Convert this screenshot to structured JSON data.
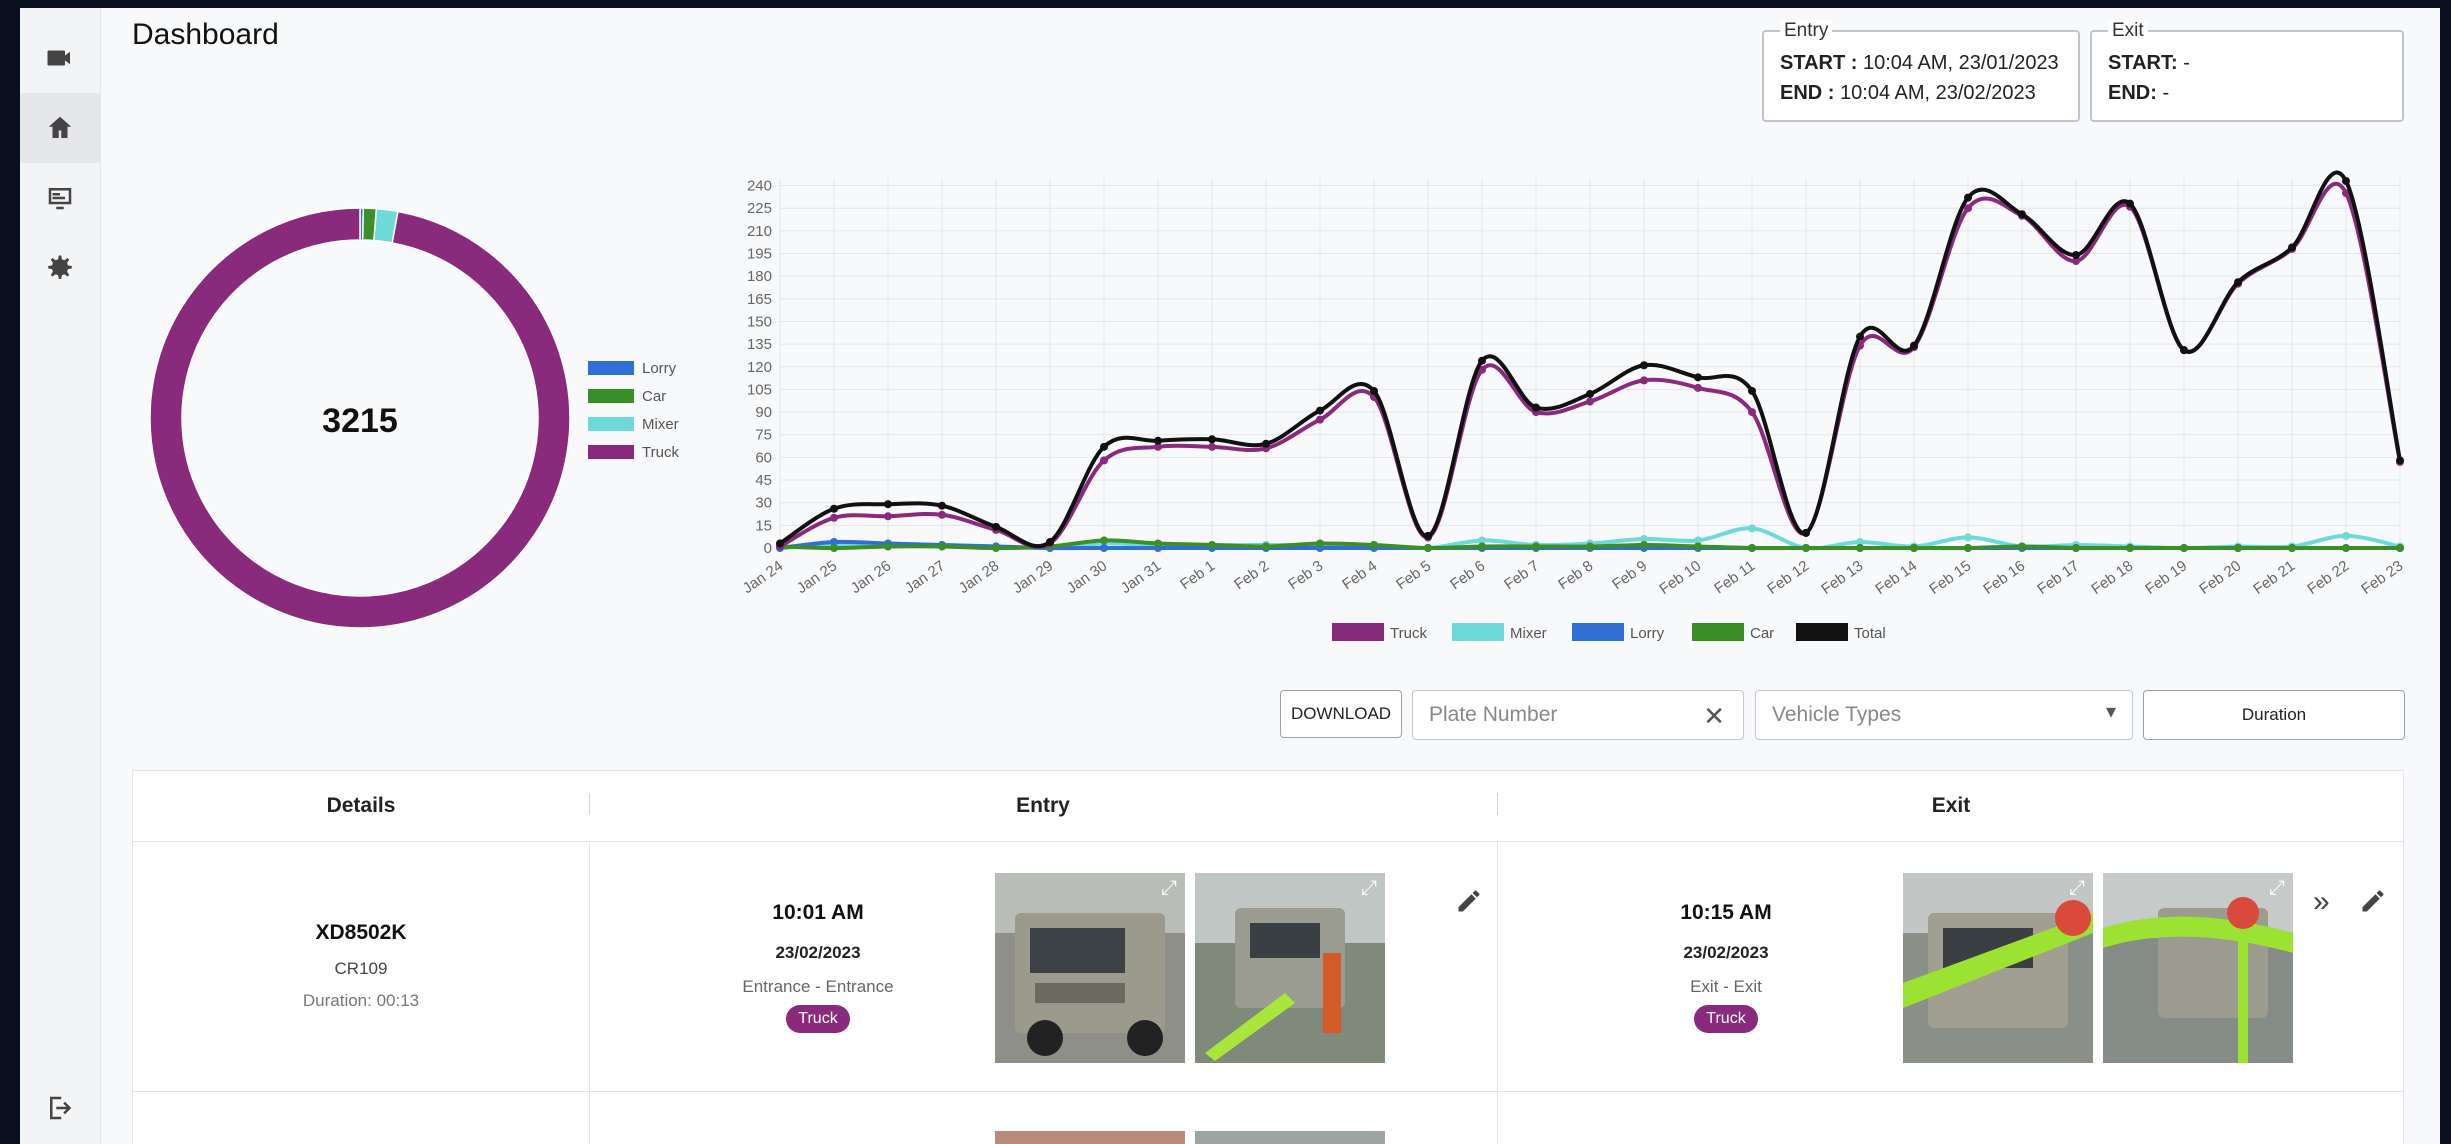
{
  "page": {
    "title": "Dashboard"
  },
  "sidebar": {
    "items": [
      {
        "name": "camera",
        "icon": "video-camera-icon"
      },
      {
        "name": "home",
        "icon": "home-icon",
        "active": true
      },
      {
        "name": "screen",
        "icon": "display-icon"
      },
      {
        "name": "settings",
        "icon": "gear-icon"
      }
    ],
    "logout_icon": "logout-icon"
  },
  "entry_range": {
    "legend": "Entry",
    "start_label": "START :",
    "start_value": "10:04 AM, 23/01/2023",
    "end_label": "END :",
    "end_value": "10:04 AM, 23/02/2023"
  },
  "exit_range": {
    "legend": "Exit",
    "start_label": "START:",
    "start_value": "-",
    "end_label": "END:",
    "end_value": "-"
  },
  "colors": {
    "truck": "#8a2a7c",
    "mixer": "#6ed9d9",
    "lorry": "#2f6fd6",
    "car": "#3a8f28",
    "total": "#111111"
  },
  "chart_data": [
    {
      "type": "pie",
      "center_label": "3215",
      "legend": [
        "Lorry",
        "Car",
        "Mixer",
        "Truck"
      ],
      "values": {
        "Lorry": 8,
        "Car": 32,
        "Mixer": 53,
        "Truck": 3122
      }
    },
    {
      "type": "line",
      "x": [
        "Jan 24",
        "Jan 25",
        "Jan 26",
        "Jan 27",
        "Jan 28",
        "Jan 29",
        "Jan 30",
        "Jan 31",
        "Feb 1",
        "Feb 2",
        "Feb 3",
        "Feb 4",
        "Feb 5",
        "Feb 6",
        "Feb 7",
        "Feb 8",
        "Feb 9",
        "Feb 10",
        "Feb 11",
        "Feb 12",
        "Feb 13",
        "Feb 14",
        "Feb 15",
        "Feb 16",
        "Feb 17",
        "Feb 18",
        "Feb 19",
        "Feb 20",
        "Feb 21",
        "Feb 22",
        "Feb 23"
      ],
      "yticks": [
        0,
        15,
        30,
        45,
        60,
        75,
        90,
        105,
        120,
        135,
        150,
        165,
        180,
        195,
        210,
        225,
        240
      ],
      "ylim": [
        0,
        245
      ],
      "grid": true,
      "legend_position": "bottom",
      "series": [
        {
          "name": "Truck",
          "color": "#8a2a7c",
          "values": [
            1,
            20,
            21,
            22,
            12,
            3,
            58,
            67,
            67,
            66,
            85,
            100,
            7,
            118,
            90,
            97,
            111,
            106,
            90,
            10,
            134,
            133,
            225,
            220,
            190,
            226,
            131,
            175,
            198,
            235,
            57
          ]
        },
        {
          "name": "Mixer",
          "color": "#6ed9d9",
          "values": [
            0,
            2,
            2,
            2,
            1,
            0,
            3,
            2,
            2,
            2,
            2,
            2,
            0,
            5,
            2,
            3,
            6,
            5,
            13,
            0,
            4,
            1,
            7,
            1,
            2,
            1,
            0,
            1,
            1,
            8,
            1
          ]
        },
        {
          "name": "Lorry",
          "color": "#2f6fd6",
          "values": [
            0,
            4,
            3,
            2,
            1,
            0,
            0,
            0,
            0,
            0,
            0,
            0,
            0,
            0,
            0,
            0,
            0,
            0,
            0,
            0,
            0,
            0,
            0,
            0,
            0,
            0,
            0,
            0,
            0,
            0,
            0
          ]
        },
        {
          "name": "Car",
          "color": "#3a8f28",
          "values": [
            1,
            0,
            1,
            1,
            0,
            1,
            5,
            3,
            2,
            1,
            3,
            2,
            0,
            1,
            1,
            1,
            2,
            1,
            0,
            0,
            0,
            0,
            0,
            1,
            0,
            0,
            0,
            0,
            0,
            0,
            0
          ]
        },
        {
          "name": "Total",
          "color": "#111111",
          "values": [
            3,
            26,
            29,
            28,
            14,
            4,
            67,
            71,
            72,
            69,
            91,
            104,
            8,
            124,
            93,
            102,
            121,
            113,
            104,
            10,
            140,
            134,
            232,
            221,
            194,
            228,
            131,
            176,
            199,
            243,
            58
          ]
        }
      ]
    }
  ],
  "filters": {
    "download_label": "DOWNLOAD",
    "plate_placeholder": "Plate Number",
    "vehicle_placeholder": "Vehicle Types",
    "duration_label": "Duration"
  },
  "table": {
    "headers": {
      "details": "Details",
      "entry": "Entry",
      "exit": "Exit"
    },
    "rows": [
      {
        "plate": "XD8502K",
        "code": "CR109",
        "duration": "Duration: 00:13",
        "entry": {
          "time": "10:01 AM",
          "date": "23/02/2023",
          "gate": "Entrance - Entrance",
          "type": "Truck"
        },
        "exit": {
          "time": "10:15 AM",
          "date": "23/02/2023",
          "gate": "Exit - Exit",
          "type": "Truck"
        }
      }
    ]
  }
}
